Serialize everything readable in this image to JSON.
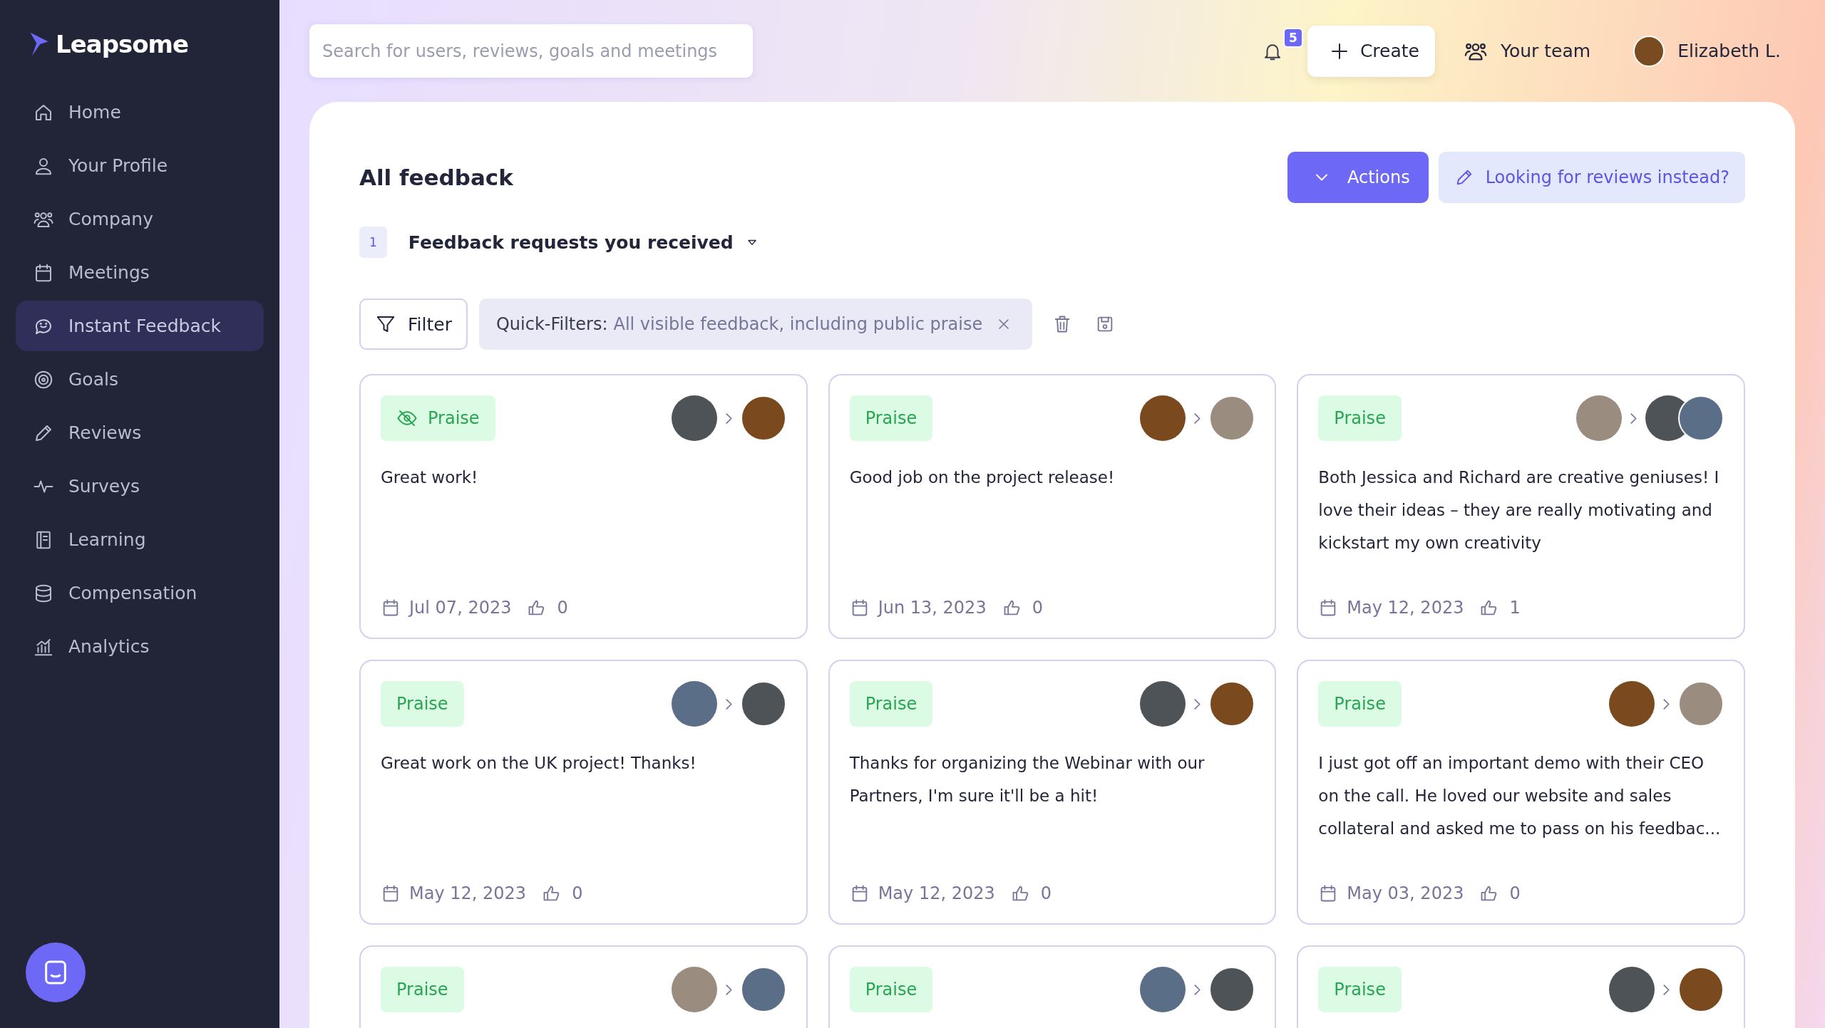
{
  "sidebar": {
    "logo": "Leapsome",
    "items": [
      {
        "label": "Home",
        "selected": false
      },
      {
        "label": "Your Profile",
        "selected": false
      },
      {
        "label": "Company",
        "selected": false
      },
      {
        "label": "Meetings",
        "selected": false
      },
      {
        "label": "Instant Feedback",
        "selected": true
      },
      {
        "label": "Goals",
        "selected": false
      },
      {
        "label": "Reviews",
        "selected": false
      },
      {
        "label": "Surveys",
        "selected": false
      },
      {
        "label": "Learning",
        "selected": false
      },
      {
        "label": "Compensation",
        "selected": false
      },
      {
        "label": "Analytics",
        "selected": false
      }
    ]
  },
  "topbar": {
    "search": {
      "placeholder": "Search for users, reviews, goals and meetings"
    },
    "notifications": "5",
    "create": "Create",
    "team": "Your team",
    "user": "Elizabeth L."
  },
  "page": {
    "title": "All feedback",
    "actions": "Actions",
    "reviews_link": "Looking for reviews instead?",
    "requests_count": "1",
    "requests_label": "Feedback requests you received",
    "filter": "Filter",
    "quick_filter": {
      "label": "Quick-Filters:",
      "value": "All visible feedback, including public praise"
    }
  },
  "cards": [
    {
      "tag": "Praise",
      "private": true,
      "group": false,
      "text": "Great work!",
      "date": "Jul 07, 2023",
      "likes": "0"
    },
    {
      "tag": "Praise",
      "private": false,
      "group": false,
      "text": "Good job on the project release!",
      "date": "Jun 13, 2023",
      "likes": "0"
    },
    {
      "tag": "Praise",
      "private": false,
      "group": true,
      "text": "Both Jessica and Richard are creative geniuses! I love their ideas – they are really motivating and kickstart my own creativity",
      "date": "May 12, 2023",
      "likes": "1"
    },
    {
      "tag": "Praise",
      "private": false,
      "group": false,
      "text": "Great work on the UK project! Thanks!",
      "date": "May 12, 2023",
      "likes": "0"
    },
    {
      "tag": "Praise",
      "private": false,
      "group": false,
      "text": "Thanks for organizing the Webinar with our Partners, I'm sure it'll be a hit!",
      "date": "May 12, 2023",
      "likes": "0"
    },
    {
      "tag": "Praise",
      "private": false,
      "group": false,
      "text": "I just got off an important demo with their CEO on the call. He loved our website and sales collateral and asked me to pass on his feedbac...",
      "date": "May 03, 2023",
      "likes": "0"
    },
    {
      "tag": "Praise",
      "private": false,
      "group": false
    },
    {
      "tag": "Praise",
      "private": false,
      "group": false
    },
    {
      "tag": "Praise",
      "private": false,
      "group": false
    }
  ]
}
